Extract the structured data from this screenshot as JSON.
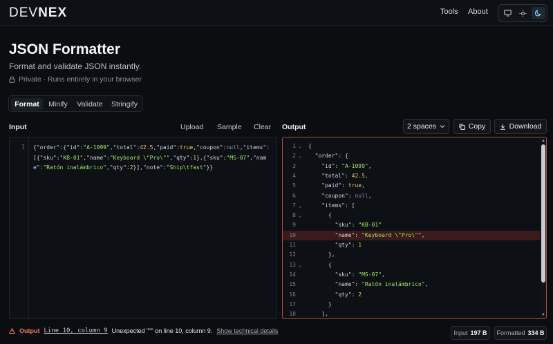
{
  "brand": {
    "part1": "DEV",
    "part2": "NEX"
  },
  "nav": {
    "tools": "Tools",
    "about": "About"
  },
  "theme": {
    "options": [
      "monitor-icon",
      "sun-icon",
      "moon-icon"
    ],
    "active": "moon-icon"
  },
  "page": {
    "title": "JSON Formatter",
    "subtitle": "Format and validate JSON instantly.",
    "privacy": "Private · Runs entirely in your browser"
  },
  "tabs": [
    {
      "label": "Format",
      "active": true
    },
    {
      "label": "Minify",
      "active": false
    },
    {
      "label": "Validate",
      "active": false
    },
    {
      "label": "Stringify",
      "active": false
    }
  ],
  "input": {
    "label": "Input",
    "upload": "Upload",
    "sample": "Sample",
    "clear": "Clear",
    "line_number": "1",
    "content": "{\"order\":{\"id\":\"A-1099\",\"total\":42.5,\"paid\":true,\"coupon\":null,\"items\":[{\"sku\":\"KB-01\",\"name\":\"Keyboard \\\"Pro\\\"\",\"qty\":1},{\"sku\":\"MS-07\",\"name\":\"Ratón inalámbrico\",\"qty\":2}],\"note\":\"Ship\\tfast\"}}"
  },
  "output": {
    "label": "Output",
    "indent_select": "2 spaces",
    "copy": "Copy",
    "download": "Download",
    "error_line": 10,
    "lines": [
      {
        "n": "1",
        "fold": "⌄",
        "code": "{"
      },
      {
        "n": "2",
        "fold": "⌄",
        "code": "  \"order\": {"
      },
      {
        "n": "3",
        "fold": "",
        "code": "    \"id\": \"A-1099\","
      },
      {
        "n": "4",
        "fold": "",
        "code": "    \"total\": 42.5,"
      },
      {
        "n": "5",
        "fold": "",
        "code": "    \"paid\": true,"
      },
      {
        "n": "6",
        "fold": "",
        "code": "    \"coupon\": null,"
      },
      {
        "n": "7",
        "fold": "⌄",
        "code": "    \"items\": ["
      },
      {
        "n": "8",
        "fold": "⌄",
        "code": "      {"
      },
      {
        "n": "9",
        "fold": "",
        "code": "        \"sku\": \"KB-01\""
      },
      {
        "n": "10",
        "fold": "",
        "code": "        \"name\": \"Keyboard \\\"Pro\\\"\","
      },
      {
        "n": "11",
        "fold": "",
        "code": "        \"qty\": 1"
      },
      {
        "n": "12",
        "fold": "",
        "code": "      },"
      },
      {
        "n": "13",
        "fold": "⌄",
        "code": "      {"
      },
      {
        "n": "14",
        "fold": "",
        "code": "        \"sku\": \"MS-07\","
      },
      {
        "n": "15",
        "fold": "",
        "code": "        \"name\": \"Ratón inalámbrico\","
      },
      {
        "n": "16",
        "fold": "",
        "code": "        \"qty\": 2"
      },
      {
        "n": "17",
        "fold": "",
        "code": "      }"
      },
      {
        "n": "18",
        "fold": "",
        "code": "    ],"
      }
    ]
  },
  "status": {
    "label": "Output",
    "location": "Line 10, column 9",
    "message": "Unexpected \"\"\" on line 10, column 9.",
    "details_link": "Show technical details",
    "input_size_label": "Input",
    "input_size": "197 B",
    "formatted_size_label": "Formatted",
    "formatted_size": "334 B"
  },
  "colors": {
    "background": "#0b0d10",
    "error": "#f07a6b",
    "error_line_bg": "#3a1a1a",
    "string": "#9fe870",
    "number": "#f2c96b"
  }
}
